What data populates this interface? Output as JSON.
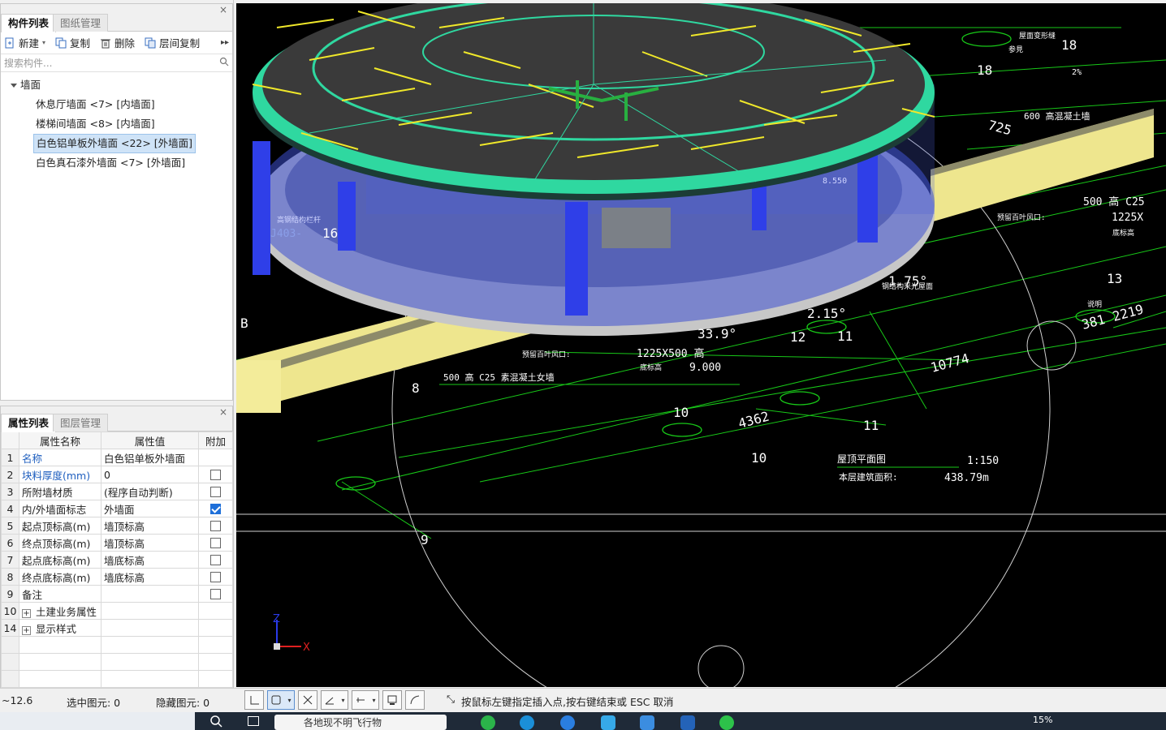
{
  "component_panel": {
    "tabs": [
      "构件列表",
      "图纸管理"
    ],
    "close": "×",
    "toolbar": {
      "new": "新建",
      "copy": "复制",
      "delete": "删除",
      "floor_copy": "层间复制",
      "more": "▸▸"
    },
    "search_placeholder": "搜索构件...",
    "tree_root": "墙面",
    "items": [
      "休息厅墙面 <7> [内墙面]",
      "楼梯间墙面 <8> [内墙面]",
      "白色铝单板外墙面 <22> [外墙面]",
      "白色真石漆外墙面 <7> [外墙面]"
    ]
  },
  "property_panel": {
    "tabs": [
      "属性列表",
      "图层管理"
    ],
    "close": "×",
    "headers": [
      "属性名称",
      "属性值",
      "附加"
    ],
    "rows": [
      {
        "idx": "1",
        "name": "名称",
        "value": "白色铝单板外墙面",
        "checkbox": "none",
        "blue": true
      },
      {
        "idx": "2",
        "name": "块料厚度(mm)",
        "value": "0",
        "checkbox": "unchecked",
        "blue": true
      },
      {
        "idx": "3",
        "name": "所附墙材质",
        "value": "(程序自动判断)",
        "checkbox": "unchecked",
        "blue": false
      },
      {
        "idx": "4",
        "name": "内/外墙面标志",
        "value": "外墙面",
        "checkbox": "checked",
        "blue": false
      },
      {
        "idx": "5",
        "name": "起点顶标高(m)",
        "value": "墙顶标高",
        "checkbox": "unchecked",
        "blue": false
      },
      {
        "idx": "6",
        "name": "终点顶标高(m)",
        "value": "墙顶标高",
        "checkbox": "unchecked",
        "blue": false
      },
      {
        "idx": "7",
        "name": "起点底标高(m)",
        "value": "墙底标高",
        "checkbox": "unchecked",
        "blue": false
      },
      {
        "idx": "8",
        "name": "终点底标高(m)",
        "value": "墙底标高",
        "checkbox": "unchecked",
        "blue": false
      },
      {
        "idx": "9",
        "name": "备注",
        "value": "",
        "checkbox": "unchecked",
        "blue": false
      },
      {
        "idx": "10",
        "name": "土建业务属性",
        "value": "",
        "checkbox": "none",
        "blue": false,
        "group": true
      },
      {
        "idx": "14",
        "name": "显示样式",
        "value": "",
        "checkbox": "none",
        "blue": false,
        "group": true
      }
    ]
  },
  "viewport": {
    "labels": {
      "area_label": "本层建筑面积:",
      "area_value": "438.79m",
      "plan_title": "屋顶平面图",
      "plan_scale": "1:150",
      "wall1": "500 高 C25 素混凝土女墙",
      "wall2": "500 高 C25",
      "vent1": "预留百叶风口:",
      "vent1_size": "1225X500 高",
      "vent2": "预留百叶风口:",
      "vent2_size": "1225X",
      "elev_label": "底标高",
      "elev_value": "9.000",
      "height_600": "600 高混凝土墙",
      "angle1": "33.9°",
      "angle2": "2.15°",
      "angle3": "1.75°",
      "dim1": "10774",
      "dim2": "4362",
      "dim3": "2219",
      "dim4": "381",
      "dim5": "725",
      "note": "说明",
      "slope": "2%",
      "deform": "屋面变形缝",
      "ref": "参見",
      "code": "J403-",
      "n16": "16",
      "n18": "18",
      "n13": "13",
      "n12": "12",
      "n11": "11",
      "n10": "10",
      "n9": "9",
      "n8": "8",
      "b": "B",
      "level": "8.550",
      "light": "钢结构采光屋面",
      "parapet": "高钢结构栏杆"
    },
    "axis": {
      "x": "X",
      "z": "Z"
    },
    "colors": {
      "background": "#000000",
      "roof_ring": "#2fd8a0",
      "rebar": "#f0e82a",
      "column": "#2f3fe8",
      "wall": "#eee68e",
      "cad_line": "#18c818"
    }
  },
  "statusbar": {
    "coord": "~12.6",
    "selected": "选中图元: 0",
    "hidden": "隐藏图元: 0",
    "hint": "按鼠标左键指定插入点,按右键结束或 ESC 取消"
  },
  "taskbar": {
    "search_text": "各地现不明飞行物",
    "percent": "15%"
  }
}
